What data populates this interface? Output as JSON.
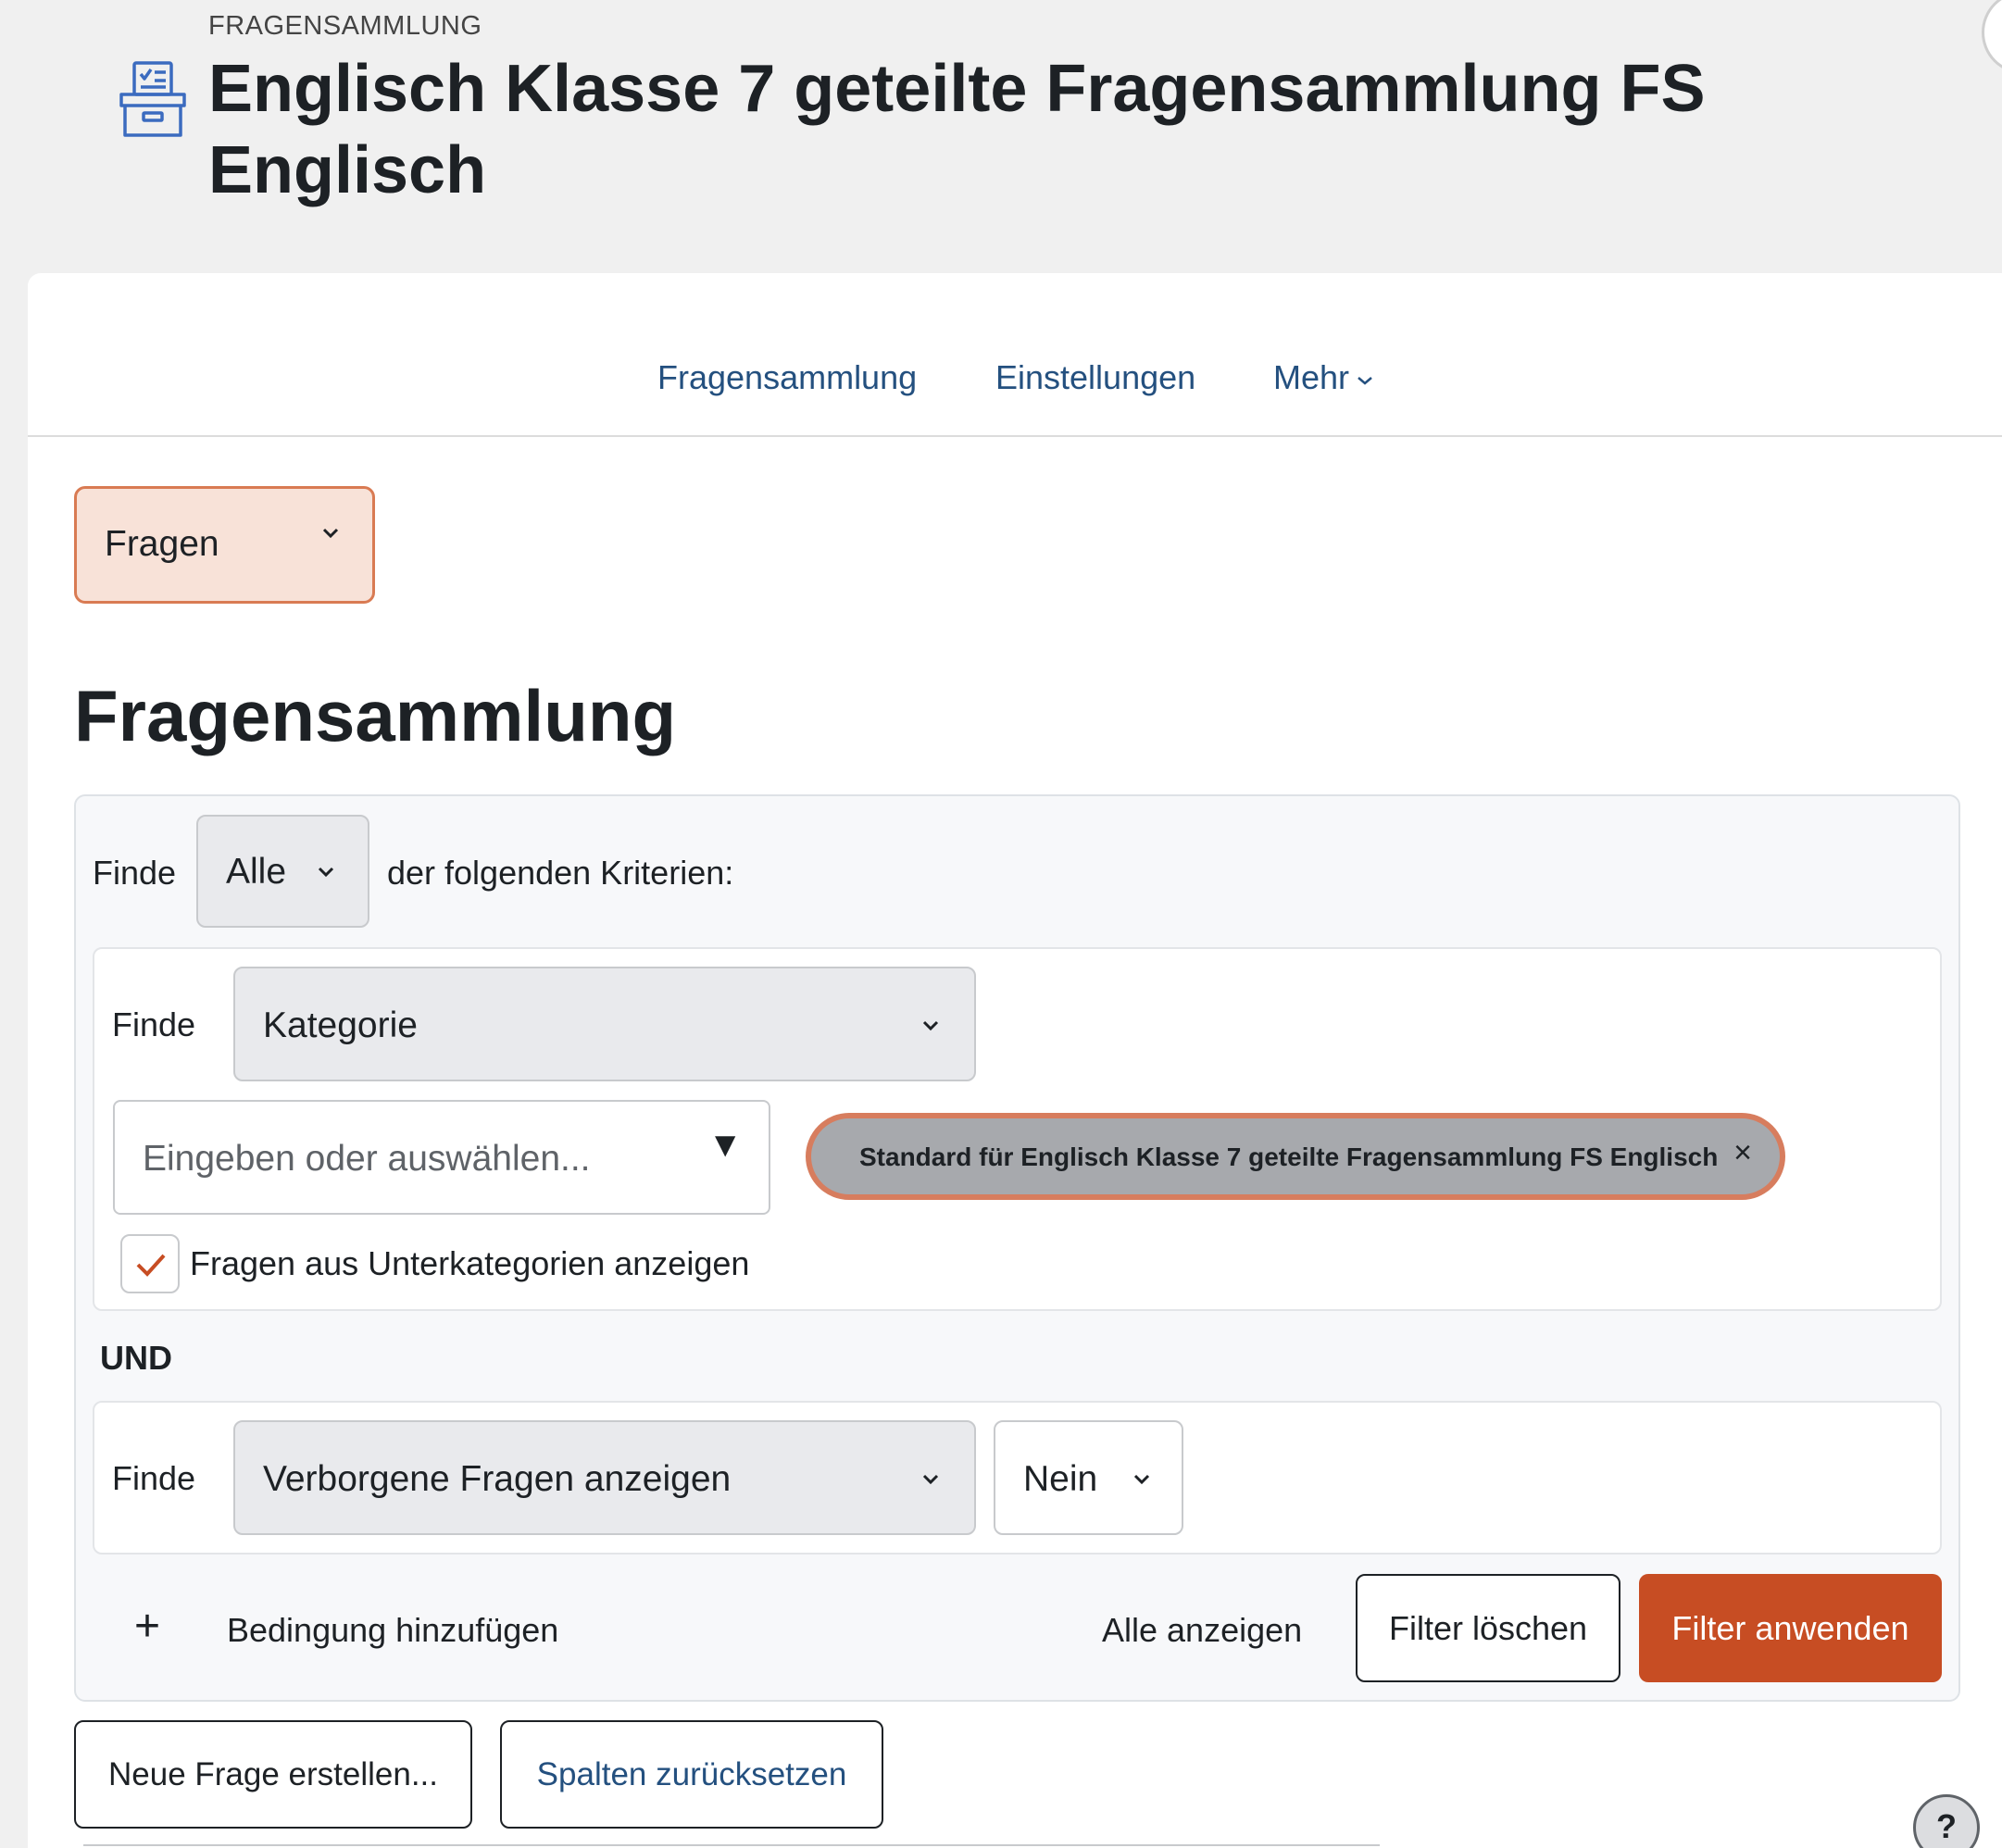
{
  "header": {
    "eyebrow": "FRAGENSAMMLUNG",
    "title": "Englisch Klasse 7 geteilte Fragensammlung FS Englisch",
    "icon": "question-bank-icon"
  },
  "secondary_nav": {
    "items": [
      {
        "label": "Fragensammlung"
      },
      {
        "label": "Einstellungen"
      },
      {
        "label": "Mehr"
      }
    ]
  },
  "page_select": {
    "value": "Fragen"
  },
  "section_title": "Fragensammlung",
  "filter": {
    "find_label": "Finde",
    "match_value": "Alle",
    "match_suffix": "der folgenden Kriterien:",
    "conditions": [
      {
        "find_label": "Finde",
        "type": "Kategorie",
        "input_placeholder": "Eingeben oder auswählen...",
        "selected_chip": "Standard für Englisch Klasse 7 geteilte Fragensammlung FS Englisch",
        "chip_remove": "×",
        "subcategories_label": "Fragen aus Unterkategorien anzeigen",
        "subcategories_checked": true
      },
      {
        "find_label": "Finde",
        "type": "Verborgene Fragen anzeigen",
        "value": "Nein"
      }
    ],
    "joiner": "UND",
    "add_condition": "Bedingung hinzufügen",
    "show_all": "Alle anzeigen",
    "clear": "Filter löschen",
    "apply": "Filter anwenden"
  },
  "actions": {
    "new_question": "Neue Frage erstellen...",
    "reset_columns": "Spalten zurücksetzen"
  },
  "help": {
    "label": "?"
  },
  "colors": {
    "accent": "#c74d23",
    "link": "#24507f",
    "highlight_border": "#d97b53"
  }
}
